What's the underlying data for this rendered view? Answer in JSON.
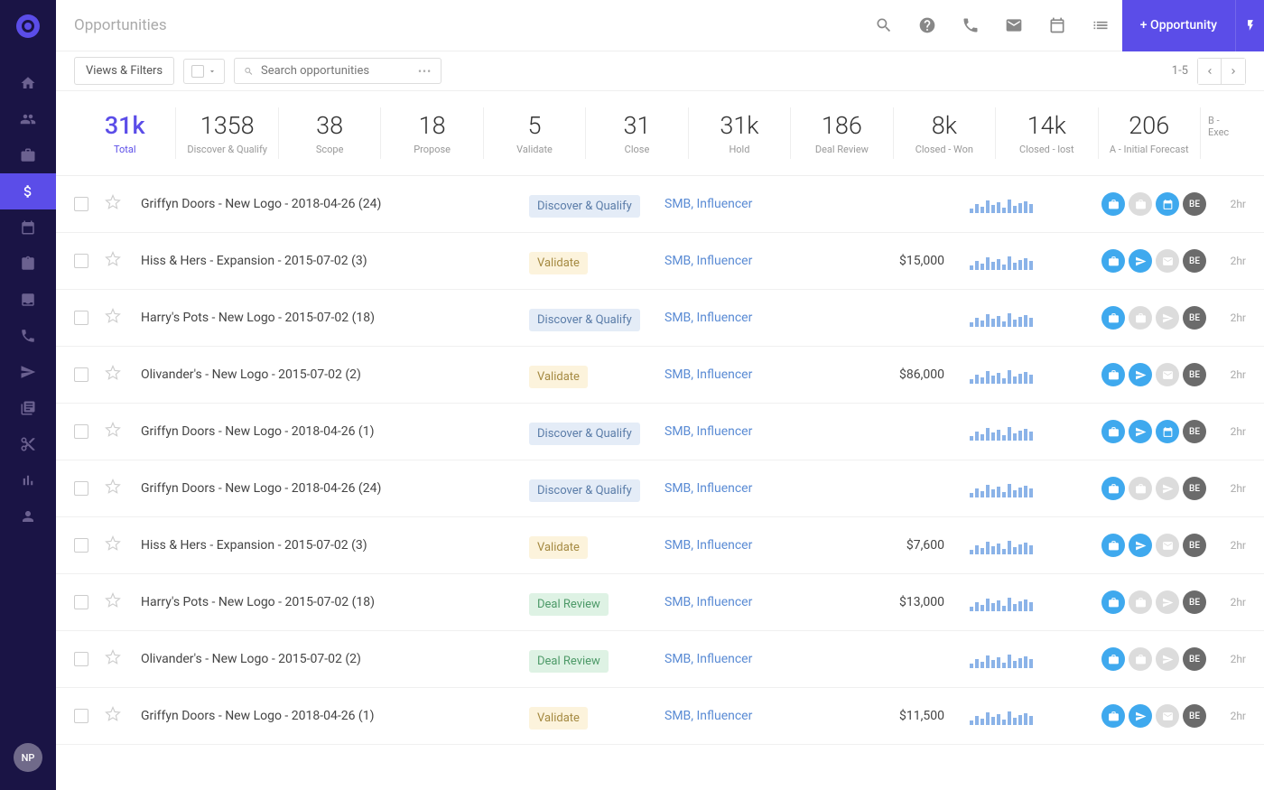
{
  "header": {
    "title": "Opportunities",
    "add_button": "+ Opportunity"
  },
  "toolbar": {
    "views_filters": "Views & Filters",
    "search_placeholder": "Search opportunities",
    "pagination": "1-5"
  },
  "sidebar": {
    "user_initials": "NP"
  },
  "stats": [
    {
      "value": "31k",
      "label": "Total"
    },
    {
      "value": "1358",
      "label": "Discover & Qualify"
    },
    {
      "value": "38",
      "label": "Scope"
    },
    {
      "value": "18",
      "label": "Propose"
    },
    {
      "value": "5",
      "label": "Validate"
    },
    {
      "value": "31",
      "label": "Close"
    },
    {
      "value": "31k",
      "label": "Hold"
    },
    {
      "value": "186",
      "label": "Deal Review"
    },
    {
      "value": "8k",
      "label": "Closed - Won"
    },
    {
      "value": "14k",
      "label": "Closed - lost"
    },
    {
      "value": "206",
      "label": "A - Initial Forecast"
    },
    {
      "value": "",
      "label": "B - Exec"
    }
  ],
  "opportunities": [
    {
      "name": "Griffyn Doors - New Logo - 2018-04-26 (24)",
      "stage": "Discover & Qualify",
      "stage_class": "st-dq",
      "tags": "SMB, Influencer",
      "amount": "",
      "icons": [
        "blue",
        "gray",
        "blue",
        "av"
      ],
      "glyphs": [
        "brief",
        "brief",
        "cal",
        "BE"
      ],
      "time": "2hr"
    },
    {
      "name": "Hiss & Hers - Expansion - 2015-07-02 (3)",
      "stage": "Validate",
      "stage_class": "st-val",
      "tags": "SMB, Influencer",
      "amount": "$15,000",
      "icons": [
        "blue",
        "blue",
        "gray",
        "av"
      ],
      "glyphs": [
        "brief",
        "plane",
        "mail",
        "BE"
      ],
      "time": "2hr"
    },
    {
      "name": "Harry's Pots - New Logo - 2015-07-02 (18)",
      "stage": "Discover & Qualify",
      "stage_class": "st-dq",
      "tags": "SMB, Influencer",
      "amount": "",
      "icons": [
        "blue",
        "gray",
        "gray",
        "av"
      ],
      "glyphs": [
        "brief",
        "brief",
        "plane",
        "BE"
      ],
      "time": "2hr"
    },
    {
      "name": "Olivander's - New Logo - 2015-07-02 (2)",
      "stage": "Validate",
      "stage_class": "st-val",
      "tags": "SMB, Influencer",
      "amount": "$86,000",
      "icons": [
        "blue",
        "blue",
        "gray",
        "av"
      ],
      "glyphs": [
        "brief",
        "plane",
        "mail",
        "BE"
      ],
      "time": "2hr"
    },
    {
      "name": "Griffyn Doors - New Logo - 2018-04-26 (1)",
      "stage": "Discover & Qualify",
      "stage_class": "st-dq",
      "tags": "SMB, Influencer",
      "amount": "",
      "icons": [
        "blue",
        "blue",
        "blue",
        "av"
      ],
      "glyphs": [
        "brief",
        "plane",
        "cal",
        "BE"
      ],
      "time": "2hr"
    },
    {
      "name": "Griffyn Doors - New Logo - 2018-04-26 (24)",
      "stage": "Discover & Qualify",
      "stage_class": "st-dq",
      "tags": "SMB, Influencer",
      "amount": "",
      "icons": [
        "blue",
        "gray",
        "gray",
        "av"
      ],
      "glyphs": [
        "brief",
        "brief",
        "plane",
        "BE"
      ],
      "time": "2hr"
    },
    {
      "name": "Hiss & Hers - Expansion - 2015-07-02 (3)",
      "stage": "Validate",
      "stage_class": "st-val",
      "tags": "SMB, Influencer",
      "amount": "$7,600",
      "icons": [
        "blue",
        "blue",
        "gray",
        "av"
      ],
      "glyphs": [
        "brief",
        "plane",
        "mail",
        "BE"
      ],
      "time": "2hr"
    },
    {
      "name": "Harry's Pots - New Logo - 2015-07-02 (18)",
      "stage": "Deal Review",
      "stage_class": "st-dr",
      "tags": "SMB, Influencer",
      "amount": "$13,000",
      "icons": [
        "blue",
        "gray",
        "gray",
        "av"
      ],
      "glyphs": [
        "brief",
        "brief",
        "plane",
        "BE"
      ],
      "time": "2hr"
    },
    {
      "name": "Olivander's - New Logo - 2015-07-02 (2)",
      "stage": "Deal Review",
      "stage_class": "st-dr",
      "tags": "SMB, Influencer",
      "amount": "",
      "icons": [
        "blue",
        "gray",
        "gray",
        "av"
      ],
      "glyphs": [
        "brief",
        "brief",
        "plane",
        "BE"
      ],
      "time": "2hr"
    },
    {
      "name": "Griffyn Doors - New Logo - 2018-04-26 (1)",
      "stage": "Validate",
      "stage_class": "st-val",
      "tags": "SMB, Influencer",
      "amount": "$11,500",
      "icons": [
        "blue",
        "blue",
        "gray",
        "av"
      ],
      "glyphs": [
        "brief",
        "plane",
        "mail",
        "BE"
      ],
      "time": "2hr"
    }
  ],
  "sparkline_heights": [
    5,
    10,
    7,
    14,
    9,
    12,
    6,
    15,
    8,
    11,
    13,
    10
  ]
}
